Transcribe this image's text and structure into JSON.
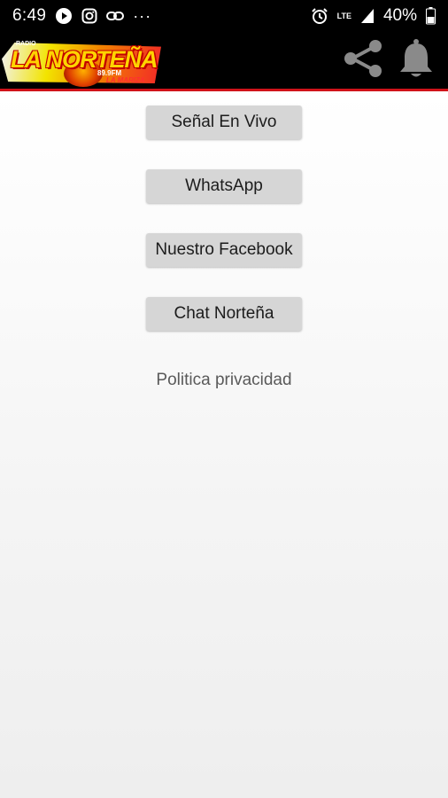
{
  "status_bar": {
    "time": "6:49",
    "battery_percent": "40%",
    "network_label": "LTE",
    "icons": [
      "play-icon",
      "instagram-icon",
      "link-icon",
      "more-dots-icon",
      "alarm-icon",
      "lte-icon",
      "signal-icon",
      "battery-icon"
    ],
    "more_label": "···"
  },
  "app_bar": {
    "logo": {
      "top_text": "RADIO",
      "main_text": "LA NORTEÑA",
      "freq_text": "89.9FM",
      "sub_text": "LA MARIZA"
    },
    "share_icon": "share-icon",
    "bell_icon": "bell-icon",
    "accent_color": "#d0131a"
  },
  "menu": {
    "buttons": [
      {
        "label": "Señal En Vivo"
      },
      {
        "label": "WhatsApp"
      },
      {
        "label": "Nuestro Facebook"
      },
      {
        "label": "Chat Norteña"
      }
    ],
    "privacy_link": "Politica privacidad"
  }
}
